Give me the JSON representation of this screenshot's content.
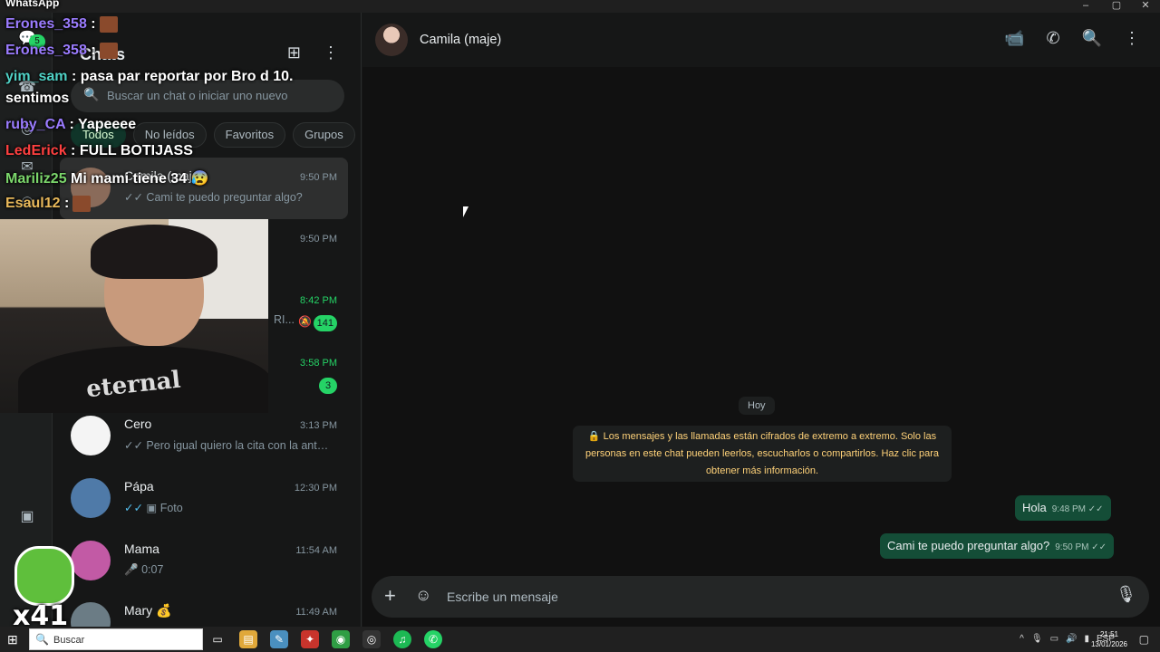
{
  "window": {
    "app_label": "WhatsApp",
    "controls": [
      "–",
      "▢",
      "✕"
    ]
  },
  "rail": {
    "unread_badge": "5"
  },
  "sidebar": {
    "title": "Chats",
    "search_placeholder": "Buscar un chat o iniciar uno nuevo",
    "chips": [
      "Todos",
      "No leídos",
      "Favoritos",
      "Grupos"
    ],
    "chats": [
      {
        "name": "Camila (maje)",
        "time": "9:50 PM",
        "preview": "Cami te puedo preguntar algo?",
        "time_green": false,
        "unread": ""
      },
      {
        "name": "",
        "time": "9:50 PM",
        "preview": "",
        "time_green": false,
        "unread": ""
      },
      {
        "name": "",
        "time": "8:42 PM",
        "preview": "RI...",
        "time_green": true,
        "unread": "141"
      },
      {
        "name": "",
        "time": "3:58 PM",
        "preview": "",
        "time_green": true,
        "unread": "3"
      },
      {
        "name": "Cero",
        "time": "3:13 PM",
        "preview": "Pero igual quiero la cita con la anto...",
        "time_green": false,
        "unread": ""
      },
      {
        "name": "Pápa",
        "time": "12:30 PM",
        "preview": "Foto",
        "time_green": false,
        "unread": ""
      },
      {
        "name": "Mama",
        "time": "11:54 AM",
        "preview": "0:07",
        "time_green": false,
        "unread": ""
      },
      {
        "name": "Mary 💰",
        "time": "11:49 AM",
        "preview": "",
        "time_green": false,
        "unread": ""
      }
    ]
  },
  "conversation": {
    "contact_name": "Camila (maje)",
    "day_label": "Hoy",
    "encryption_notice": "🔒 Los mensajes y las llamadas están cifrados de extremo a extremo. Solo las personas en este chat pueden leerlos, escucharlos o compartirlos. Haz clic para obtener más información.",
    "messages": [
      {
        "text": "Hola",
        "time": "9:48 PM",
        "ticks": "✓✓"
      },
      {
        "text": "Cami te puedo preguntar algo?",
        "time": "9:50 PM",
        "ticks": "✓✓"
      }
    ],
    "composer_placeholder": "Escribe un mensaje"
  },
  "stream_chat": [
    {
      "user": "Erones_358",
      "color": "#9b7cff",
      "text": ":"
    },
    {
      "user": "Erones_358",
      "color": "#9b7cff",
      "text": ":"
    },
    {
      "user": "yim_sam",
      "color": "#4fd1c5",
      "text": ": pasa par reportar por Bro d 10."
    },
    {
      "user": "sentimos",
      "color": "#ffffff",
      "text": ""
    },
    {
      "user": "ruby_CA",
      "color": "#9b7cff",
      "text": ": Yapeeee"
    },
    {
      "user": "LedErick",
      "color": "#ff4040",
      "text": ": FULL BOTIJASS"
    },
    {
      "user": "Mariliz25",
      "color": "#7bd66b",
      "text": "Mi mami tiene 34 😰"
    },
    {
      "user": "Esaul12",
      "color": "#e8b85a",
      "text": ":"
    }
  ],
  "webcam": {
    "shirt_text": "eternal"
  },
  "sticker": {
    "text": "x41"
  },
  "taskbar": {
    "search_placeholder": "Buscar",
    "lang": "ESP",
    "time": "21:51",
    "date": "13/01/2026"
  }
}
